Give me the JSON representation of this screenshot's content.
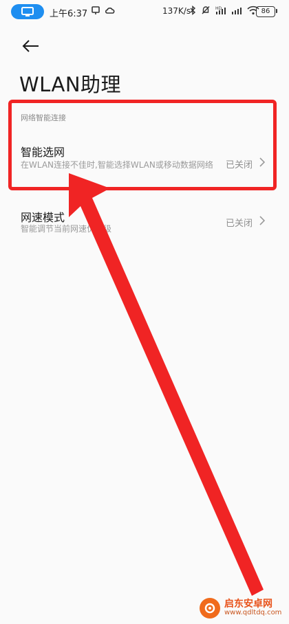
{
  "status_bar": {
    "time": "上午6:37",
    "speed": "137K/s",
    "battery": "86",
    "network_label": "4G",
    "icons": [
      "screen-cast-icon",
      "alarm-icon",
      "cloud-icon",
      "bluetooth-icon",
      "mute-bell-icon",
      "hd-signal-icon",
      "signal-icon",
      "wifi-icon"
    ]
  },
  "header": {
    "back_icon": "back-arrow-icon",
    "title": "WLAN助理"
  },
  "section": {
    "title": "网络智能连接"
  },
  "rows": [
    {
      "title": "智能选网",
      "desc": "在WLAN连接不佳时,智能选择WLAN或移动数据网络",
      "status": "已关闭"
    },
    {
      "title": "网速模式",
      "desc": "智能调节当前网速优先级",
      "status": "已关闭"
    }
  ],
  "annotation": {
    "color": "#f02424"
  },
  "watermark": {
    "title": "启东安卓网",
    "url": "www.qdltdq.com"
  }
}
